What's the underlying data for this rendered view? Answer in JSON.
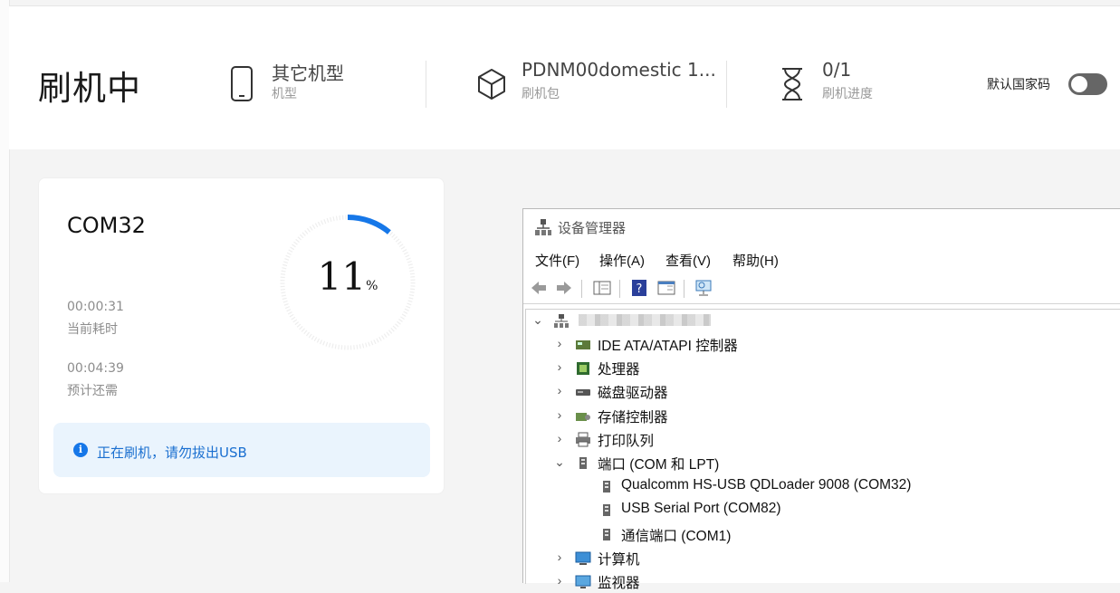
{
  "header": {
    "title": "刷机中",
    "model": {
      "value": "其它机型",
      "label": "机型",
      "icon": "phone-icon"
    },
    "package": {
      "value": "PDNM00domestic 1...",
      "label": "刷机包",
      "icon": "package-box-icon"
    },
    "progress": {
      "value": "0/1",
      "label": "刷机进度",
      "icon": "hourglass-icon"
    },
    "toggle": {
      "label": "默认国家码",
      "on": false
    }
  },
  "card": {
    "port": "COM32",
    "percent_value": 11,
    "percent_number": "11",
    "percent_unit": "%",
    "elapsed_value": "00:00:31",
    "elapsed_label": "当前耗时",
    "remaining_value": "00:04:39",
    "remaining_label": "预计还需",
    "notice": "正在刷机，请勿拔出USB",
    "accent": "#1677e8"
  },
  "device_manager": {
    "title": "设备管理器",
    "menu": [
      "文件(F)",
      "操作(A)",
      "查看(V)",
      "帮助(H)"
    ],
    "tree": [
      {
        "text": "IDE ATA/ATAPI 控制器",
        "icon": "ide-controller-icon",
        "expanded": false,
        "indent": 1
      },
      {
        "text": "处理器",
        "icon": "processor-icon",
        "expanded": false,
        "indent": 1
      },
      {
        "text": "磁盘驱动器",
        "icon": "disk-drive-icon",
        "expanded": false,
        "indent": 1
      },
      {
        "text": "存储控制器",
        "icon": "storage-controller-icon",
        "expanded": false,
        "indent": 1
      },
      {
        "text": "打印队列",
        "icon": "printer-icon",
        "expanded": false,
        "indent": 1
      },
      {
        "text": "端口 (COM 和 LPT)",
        "icon": "port-icon",
        "expanded": true,
        "indent": 1
      },
      {
        "text": "Qualcomm HS-USB QDLoader 9008 (COM32)",
        "icon": "port-icon",
        "indent": 2
      },
      {
        "text": "USB Serial Port (COM82)",
        "icon": "port-icon",
        "indent": 2
      },
      {
        "text": "通信端口 (COM1)",
        "icon": "port-icon",
        "indent": 2
      },
      {
        "text": "计算机",
        "icon": "computer-icon",
        "expanded": false,
        "indent": 1
      },
      {
        "text": "监视器",
        "icon": "monitor-icon",
        "expanded": false,
        "indent": 1
      }
    ]
  }
}
